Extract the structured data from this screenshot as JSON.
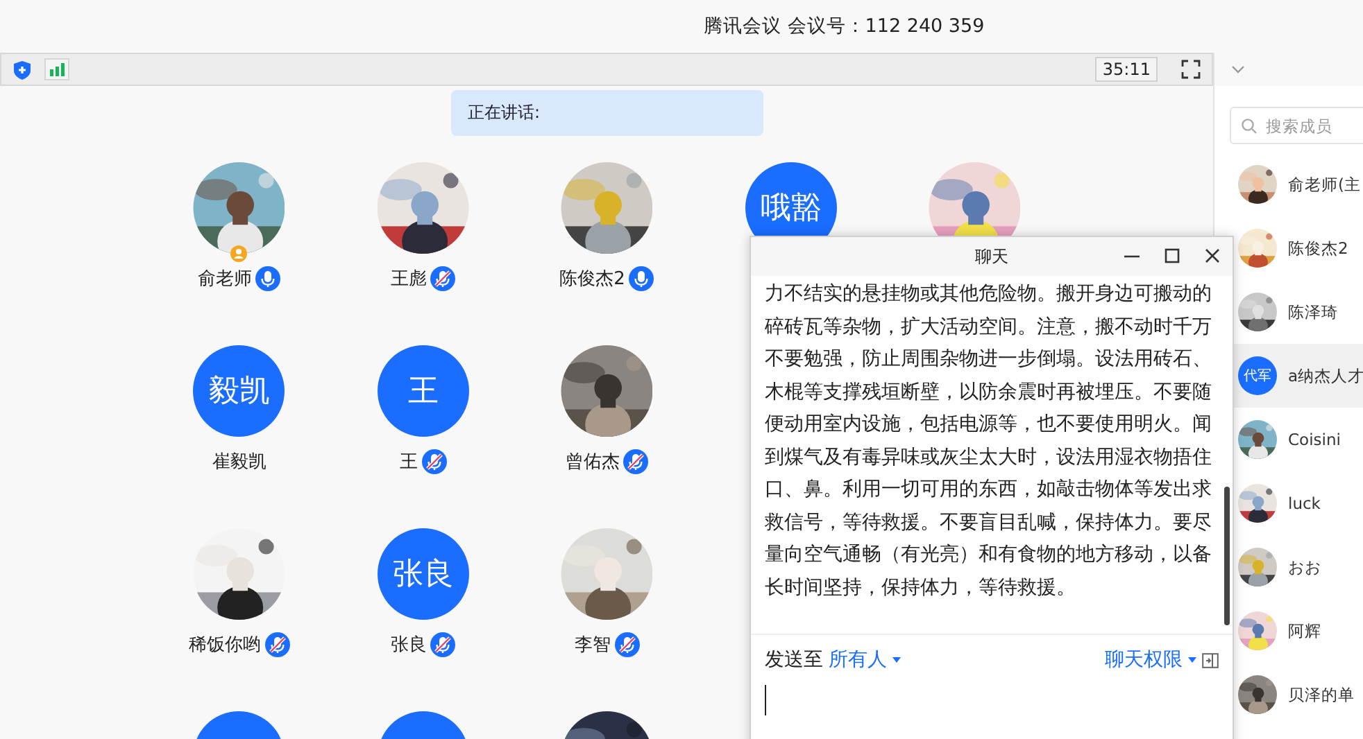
{
  "header": {
    "title": "腾讯会议 会议号：112 240 359"
  },
  "toolbar": {
    "timer": "35:11"
  },
  "speaking": {
    "label": "正在讲话:"
  },
  "grid": {
    "rows": [
      [
        {
          "name": "俞老师",
          "host": true,
          "mic_muted": false
        },
        {
          "name": "王彪",
          "host": false,
          "mic_muted": true
        },
        {
          "name": "陈俊杰2",
          "host": false,
          "mic_muted": false
        },
        {
          "avatar": {
            "kind": "initials",
            "text": "哦豁"
          },
          "host": false
        },
        {
          "host": false
        }
      ],
      [
        {
          "avatar": {
            "kind": "initials",
            "text": "毅凯"
          },
          "name": "崔毅凯",
          "host": false
        },
        {
          "avatar": {
            "kind": "initials",
            "text": "王"
          },
          "name": "王",
          "host": false,
          "mic_muted": true
        },
        {
          "name": "曾佑杰",
          "host": false,
          "mic_muted": true
        }
      ],
      [
        {
          "name": "稀饭你哟",
          "host": false,
          "mic_muted": true
        },
        {
          "avatar": {
            "kind": "initials",
            "text": "张良"
          },
          "name": "张良",
          "host": false,
          "mic_muted": true
        },
        {
          "name": "李智",
          "host": false,
          "mic_muted": true
        }
      ],
      [
        {
          "avatar": {
            "kind": "initials"
          },
          "host": false
        },
        {
          "avatar": {
            "kind": "initials"
          },
          "host": false
        },
        {
          "host": false
        }
      ]
    ]
  },
  "chat": {
    "title": "聊天",
    "message": "力不结实的悬挂物或其他危险物。搬开身边可搬动的碎砖瓦等杂物，扩大活动空间。注意，搬不动时千万不要勉强，防止周围杂物进一步倒塌。设法用砖石、木棍等支撑残垣断壁，以防余震时再被埋压。不要随便动用室内设施，包括电源等，也不要使用明火。闻到煤气及有毒异味或灰尘太大时，设法用湿衣物捂住口、鼻。利用一切可用的东西，如敲击物体等发出求救信号，等待救援。不要盲目乱喊，保持体力。要尽量向空气通畅（有光亮）和有食物的地方移动，以备长时间坚持，保持体力，等待救援。",
    "send_to_label": "发送至",
    "recipient": "所有人",
    "permissions": "聊天权限"
  },
  "members": {
    "search_placeholder": "搜索成员",
    "items": [
      {
        "name": "俞老师(主",
        "selected": false
      },
      {
        "name": "陈俊杰2",
        "selected": false
      },
      {
        "name": "陈泽琦",
        "selected": false
      },
      {
        "avatar": {
          "kind": "initials",
          "text": "代军"
        },
        "name": "a纳杰人才",
        "selected": true
      },
      {
        "name": "Coisini",
        "selected": false
      },
      {
        "name": "luck",
        "selected": false
      },
      {
        "name": "おお",
        "selected": false
      },
      {
        "name": "阿辉",
        "selected": false
      },
      {
        "name": "贝泽的单",
        "selected": false
      }
    ]
  }
}
